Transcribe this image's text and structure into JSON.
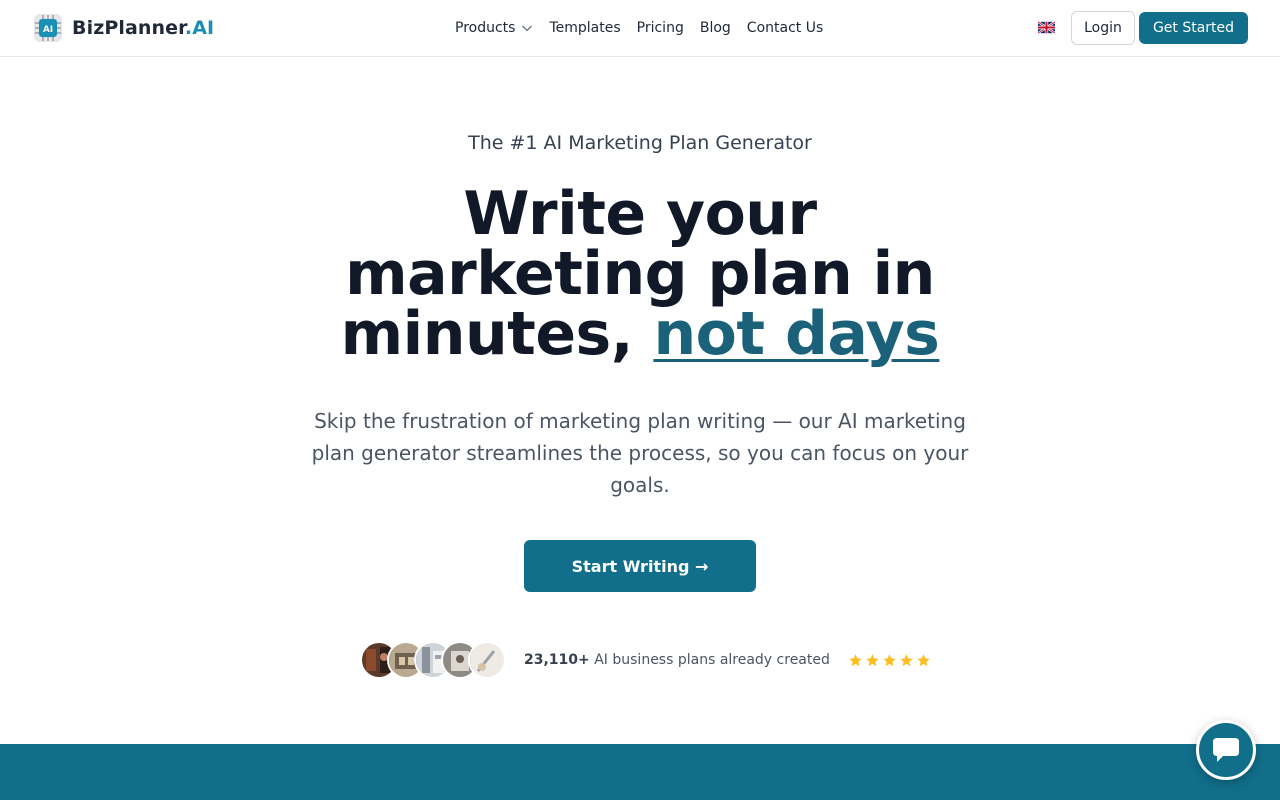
{
  "brand": {
    "name": "BizPlanner",
    "suffix": ".AI"
  },
  "nav": {
    "items": [
      {
        "label": "Products",
        "has_dropdown": true
      },
      {
        "label": "Templates"
      },
      {
        "label": "Pricing"
      },
      {
        "label": "Blog"
      },
      {
        "label": "Contact Us"
      }
    ]
  },
  "header": {
    "language_icon": "uk-flag-icon",
    "login_label": "Login",
    "get_started_label": "Get Started"
  },
  "hero": {
    "eyebrow": "The #1 AI Marketing Plan Generator",
    "headline_main": "Write your marketing plan in minutes,",
    "headline_highlight": "not days",
    "subtext": "Skip the frustration of marketing plan writing — our AI marketing plan generator streamlines the process, so you can focus on your goals.",
    "cta_label": "Start Writing →"
  },
  "social_proof": {
    "count": "23,110+",
    "text": "AI business plans already created",
    "rating_stars": 5,
    "avatar_count": 5
  },
  "colors": {
    "primary": "#116f8c",
    "headline_accent": "#1a6179",
    "logo_accent": "#1b8fb3",
    "star": "#fbbf24"
  },
  "chat": {
    "icon": "chat-bubble-icon"
  }
}
